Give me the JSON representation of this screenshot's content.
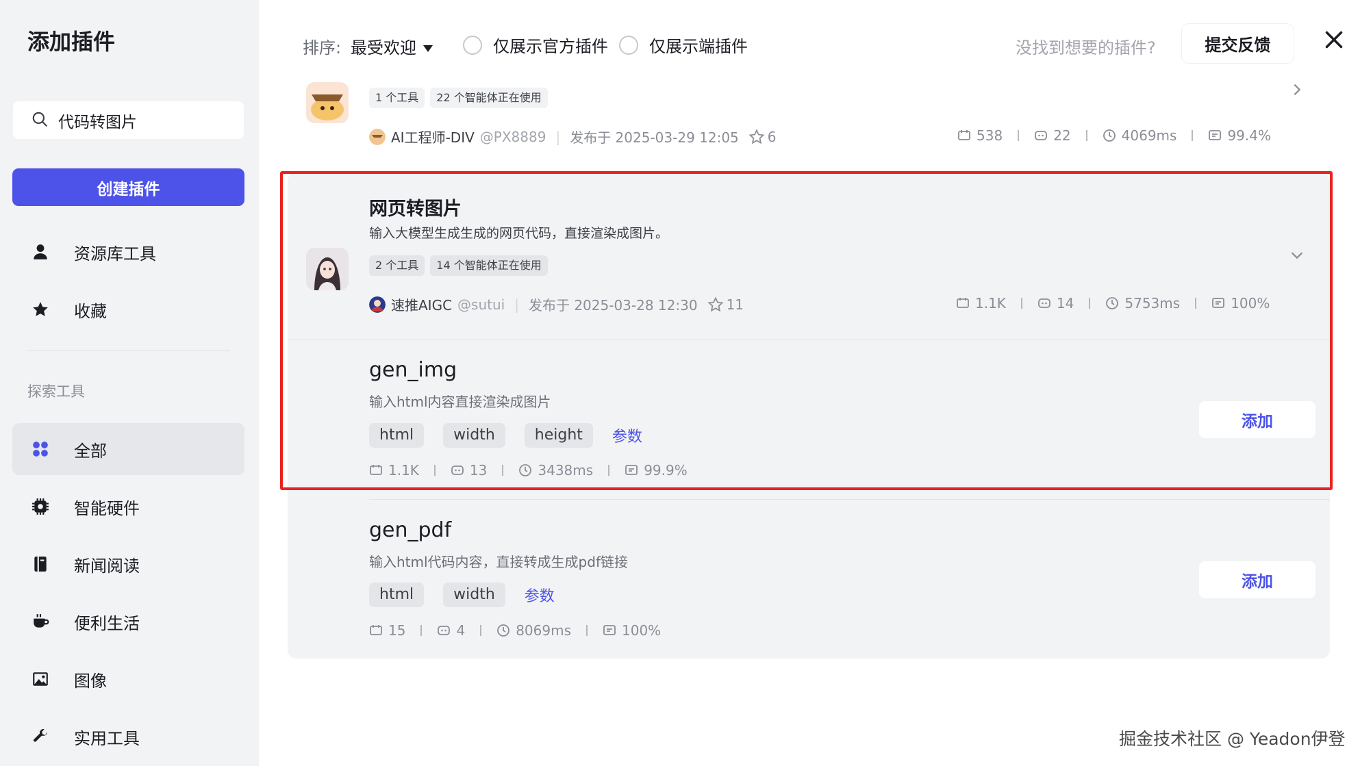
{
  "sidebar": {
    "title": "添加插件",
    "search_value": "代码转图片",
    "create_label": "创建插件",
    "items": [
      {
        "label": "资源库工具",
        "icon": "person-icon"
      },
      {
        "label": "收藏",
        "icon": "star-icon"
      }
    ],
    "section_label": "探索工具",
    "explore": [
      {
        "label": "全部",
        "icon": "grid-icon",
        "active": true
      },
      {
        "label": "智能硬件",
        "icon": "chip-icon"
      },
      {
        "label": "新闻阅读",
        "icon": "book-icon"
      },
      {
        "label": "便利生活",
        "icon": "cup-icon"
      },
      {
        "label": "图像",
        "icon": "image-icon"
      },
      {
        "label": "实用工具",
        "icon": "wrench-icon"
      }
    ]
  },
  "topbar": {
    "sort_label": "排序:",
    "sort_value": "最受欢迎",
    "radio_official": "仅展示官方插件",
    "radio_client": "仅展示端插件",
    "not_found": "没找到想要的插件?",
    "feedback": "提交反馈"
  },
  "plugins": [
    {
      "tools_count": "1 个工具",
      "agents_using": "22 个智能体正在使用",
      "author": "AI工程师-DIV",
      "handle": "@PX8889",
      "published": "发布于 2025-03-29 12:05",
      "stars": "6",
      "stats": {
        "calls": "538",
        "bots": "22",
        "latency": "4069ms",
        "success": "99.4%"
      }
    },
    {
      "name": "网页转图片",
      "description": "输入大模型生成生成的网页代码，直接渲染成图片。",
      "tools_count": "2 个工具",
      "agents_using": "14 个智能体正在使用",
      "author": "速推AIGC",
      "handle": "@sutui",
      "published": "发布于 2025-03-28 12:30",
      "stars": "11",
      "stats": {
        "calls": "1.1K",
        "bots": "14",
        "latency": "5753ms",
        "success": "100%"
      },
      "tools": [
        {
          "name": "gen_img",
          "description": "输入html内容直接渲染成图片",
          "params": [
            "html",
            "width",
            "height"
          ],
          "params_link": "参数",
          "add_label": "添加",
          "stats": {
            "calls": "1.1K",
            "bots": "13",
            "latency": "3438ms",
            "success": "99.9%"
          }
        },
        {
          "name": "gen_pdf",
          "description": "输入html代码内容，直接转成生成pdf链接",
          "params": [
            "html",
            "width"
          ],
          "params_link": "参数",
          "add_label": "添加",
          "stats": {
            "calls": "15",
            "bots": "4",
            "latency": "8069ms",
            "success": "100%"
          }
        }
      ]
    }
  ],
  "watermark": "掘金技术社区 @ Yeadon伊登",
  "colors": {
    "accent": "#4d53e8",
    "highlight": "#e8231f",
    "sidebar_bg": "#f2f3f5"
  }
}
